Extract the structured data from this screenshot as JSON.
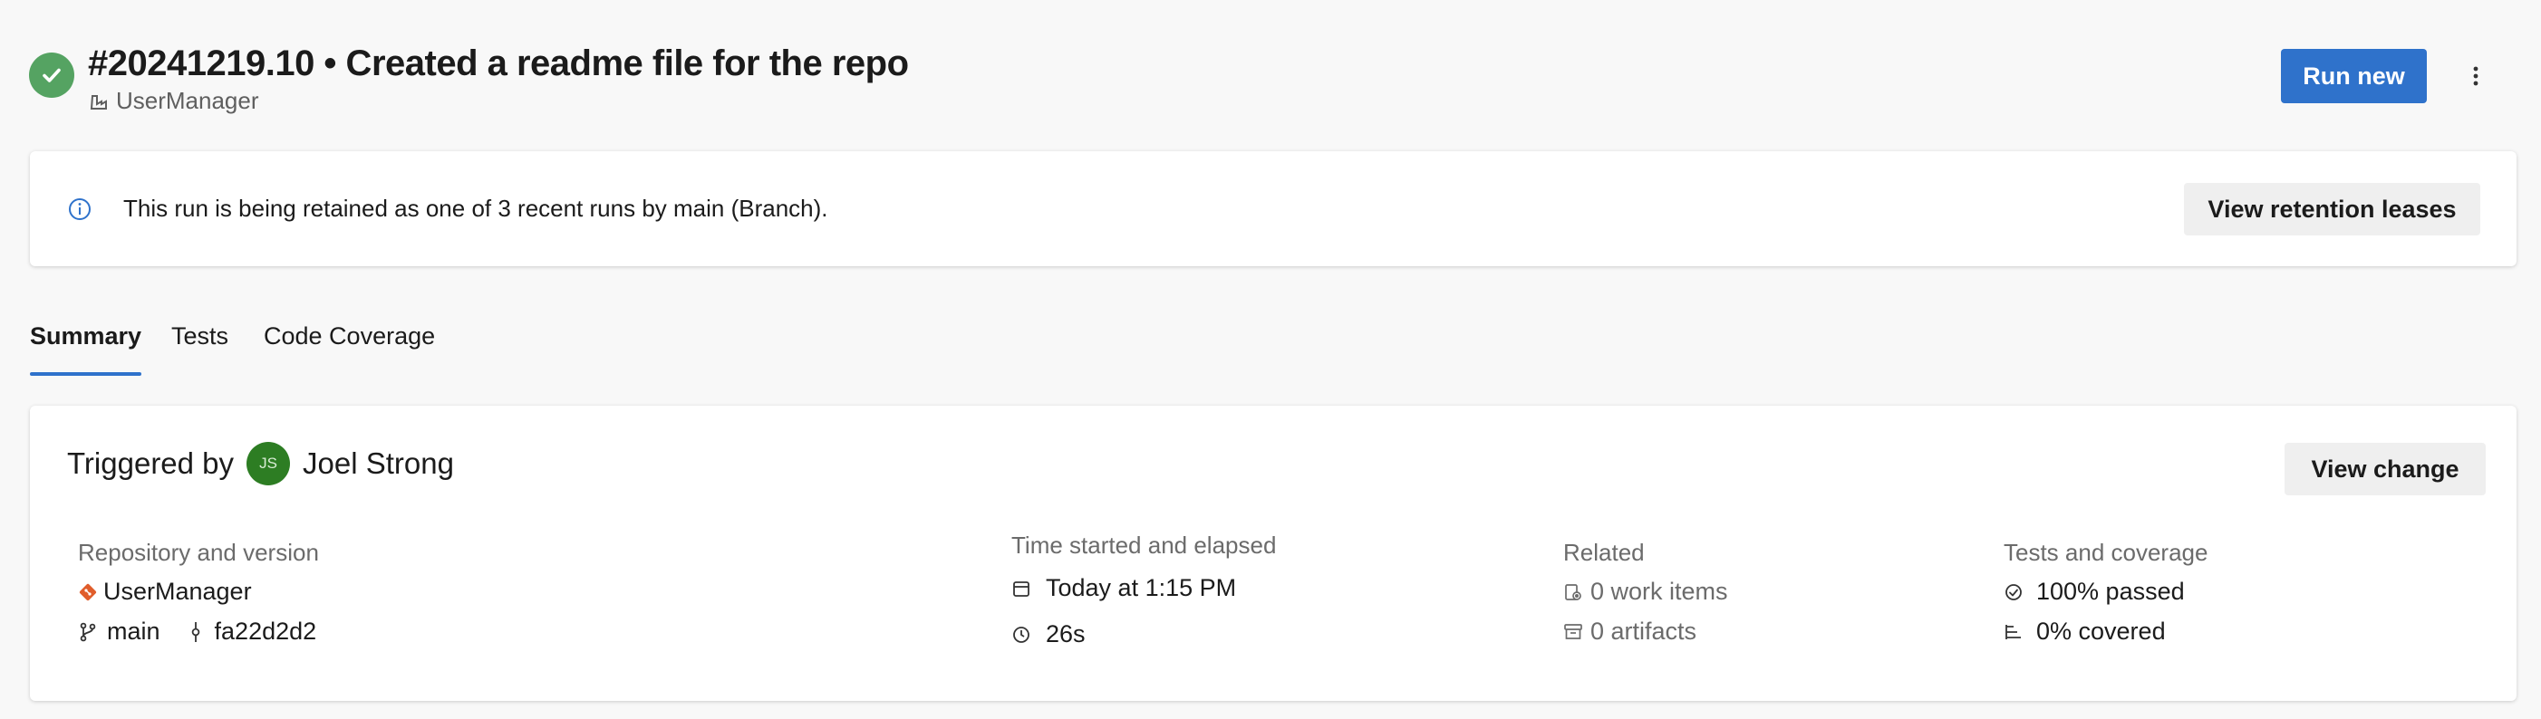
{
  "header": {
    "run_title": "#20241219.10 • Created a readme file for the repo",
    "pipeline_name": "UserManager",
    "run_new_label": "Run new"
  },
  "banner": {
    "message": "This run is being retained as one of 3 recent runs by main (Branch).",
    "button_label": "View retention leases"
  },
  "tabs": [
    {
      "label": "Summary",
      "active": true
    },
    {
      "label": "Tests",
      "active": false
    },
    {
      "label": "Code Coverage",
      "active": false
    }
  ],
  "summary": {
    "triggered_prefix": "Triggered by",
    "user_initials": "JS",
    "user_name": "Joel Strong",
    "view_change_label": "View change",
    "repository": {
      "heading": "Repository and version",
      "repo_name": "UserManager",
      "branch": "main",
      "commit": "fa22d2d2"
    },
    "time": {
      "heading": "Time started and elapsed",
      "started": "Today at 1:15 PM",
      "elapsed": "26s"
    },
    "related": {
      "heading": "Related",
      "work_items": "0 work items",
      "artifacts": "0 artifacts"
    },
    "tests": {
      "heading": "Tests and coverage",
      "passed": "100% passed",
      "covered": "0% covered"
    }
  },
  "colors": {
    "success": "#55a362",
    "accent": "#2f72cb",
    "avatar": "#2d7d23",
    "git": "#e05d2b"
  }
}
